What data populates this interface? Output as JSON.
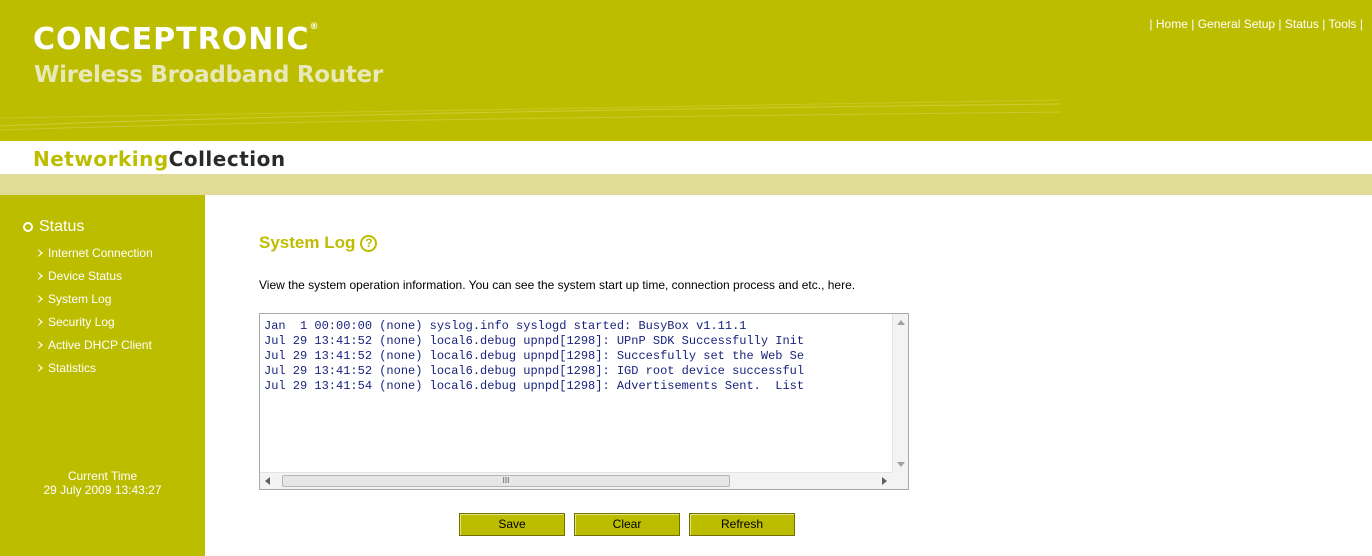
{
  "header": {
    "brand": "CONCEPTRONIC",
    "brand_mark": "®",
    "subtitle": "Wireless Broadband Router",
    "collection_part1": "Networking",
    "collection_part2": "Collection",
    "nav": {
      "separator": "|",
      "items": [
        "Home",
        "General Setup",
        "Status",
        "Tools"
      ]
    }
  },
  "sidebar": {
    "section_title": "Status",
    "items": [
      "Internet Connection",
      "Device Status",
      "System Log",
      "Security Log",
      "Active DHCP Client",
      "Statistics"
    ],
    "clock_label": "Current Time",
    "clock_value": "29 July 2009 13:43:27"
  },
  "main": {
    "title": "System Log",
    "description": "View the system operation information. You can see the system start up time, connection process and etc., here.",
    "log_lines": [
      "Jan  1 00:00:00 (none) syslog.info syslogd started: BusyBox v1.11.1",
      "Jul 29 13:41:52 (none) local6.debug upnpd[1298]: UPnP SDK Successfully Init",
      "Jul 29 13:41:52 (none) local6.debug upnpd[1298]: Succesfully set the Web Se",
      "Jul 29 13:41:52 (none) local6.debug upnpd[1298]: IGD root device successful",
      "Jul 29 13:41:54 (none) local6.debug upnpd[1298]: Advertisements Sent.  List"
    ],
    "scroll_grip": "III",
    "buttons": {
      "save": "Save",
      "clear": "Clear",
      "refresh": "Refresh"
    }
  },
  "colors": {
    "olive": "#bdbd00",
    "stripe": "#e0dc98",
    "log_text": "#1a237e"
  }
}
